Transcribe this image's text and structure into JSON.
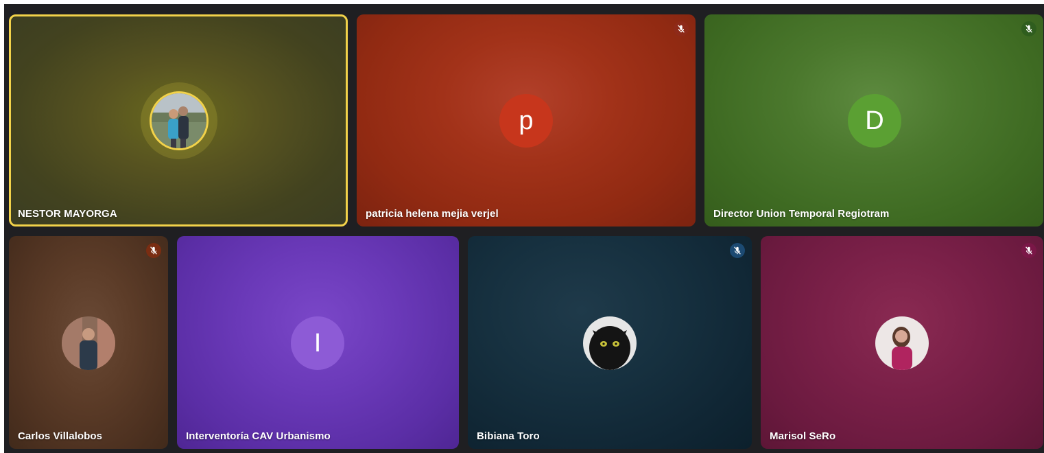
{
  "participants": [
    {
      "name": "NESTOR MAYORGA",
      "speaking": true,
      "avatar": "photo-icon",
      "muted": false
    },
    {
      "name": "patricia helena mejia verjel",
      "initial": "p",
      "muted": true,
      "mic_color": "#8e2a19"
    },
    {
      "name": "Director Union Temporal Regiotram",
      "initial": "D",
      "muted": true,
      "mic_color": "#2f5d1e"
    },
    {
      "name": "Carlos Villalobos",
      "avatar": "photo-icon",
      "muted": true,
      "mic_color": "#7a2d12"
    },
    {
      "name": "Interventoría CAV Urbanismo",
      "initial": "I",
      "muted": false
    },
    {
      "name": "Bibiana Toro",
      "avatar": "photo-icon",
      "muted": true,
      "mic_color": "#1c4a72"
    },
    {
      "name": "Marisol SeRo",
      "avatar": "photo-icon",
      "muted": true,
      "mic_color": "#7a1747"
    }
  ],
  "colors": {
    "speaking_border": "#f2d24a",
    "background": "#1f1f22"
  },
  "icons": {
    "muted_mic": "mic-off-icon"
  }
}
